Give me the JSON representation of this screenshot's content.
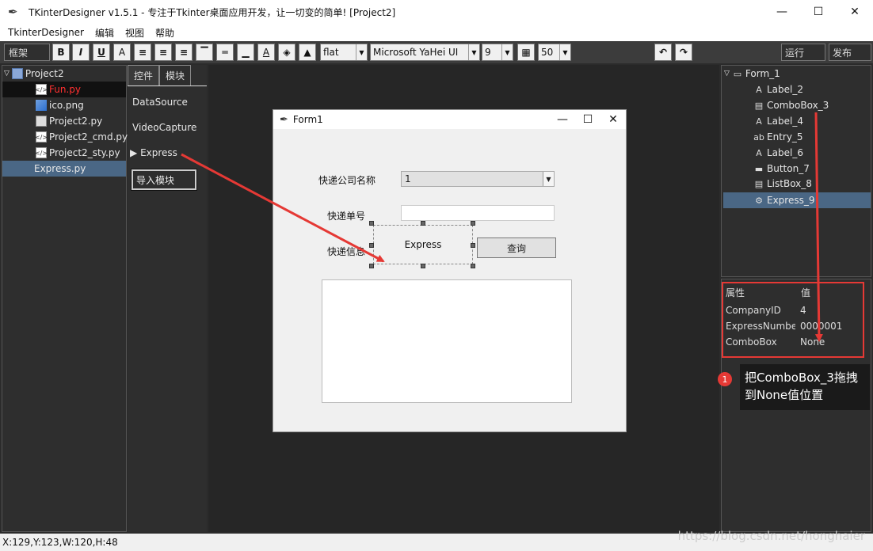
{
  "window": {
    "title": "TKinterDesigner v1.5.1 - 专注于Tkinter桌面应用开发，让一切变的简单!    [Project2]",
    "minimize": "—",
    "maximize": "☐",
    "close": "✕"
  },
  "menu": [
    "TkinterDesigner",
    "编辑",
    "视图",
    "帮助"
  ],
  "toolbar": {
    "frame_label": "框架",
    "bold": "B",
    "italic": "I",
    "underline": "U",
    "font_a": "A",
    "relief": "flat",
    "font_family": "Microsoft YaHei UI",
    "font_size": "9",
    "grid_size": "50",
    "run_label": "运行",
    "publish_label": "发布"
  },
  "project_tree": {
    "root": "Project2",
    "items": [
      "Fun.py",
      "ico.png",
      "Project2.py",
      "Project2_cmd.py",
      "Project2_sty.py",
      "Express.py"
    ]
  },
  "module_panel": {
    "tabs": [
      "控件",
      "模块"
    ],
    "items": [
      "DataSource",
      "VideoCapture",
      "Express"
    ],
    "import_button": "导入模块"
  },
  "form": {
    "title": "Form1",
    "label_company": "快递公司名称",
    "combo_value": "1",
    "label_number": "快递单号",
    "label_info": "快递信息",
    "express_widget": "Express",
    "query_button": "查询"
  },
  "object_tree": {
    "root": "Form_1",
    "items": [
      "Label_2",
      "ComboBox_3",
      "Label_4",
      "Entry_5",
      "Label_6",
      "Button_7",
      "ListBox_8",
      "Express_9"
    ],
    "selected": "Express_9"
  },
  "properties": {
    "header_name": "属性",
    "header_value": "值",
    "rows": [
      {
        "name": "CompanyID",
        "value": "4"
      },
      {
        "name": "ExpressNumbe",
        "value": "0000001"
      },
      {
        "name": "ComboBox",
        "value": "None"
      }
    ]
  },
  "annotation": {
    "badge": "1",
    "text": "把ComboBox_3拖拽到None值位置"
  },
  "status": "X:129,Y:123,W:120,H:48",
  "watermark": "https://blog.csdn.net/honghaier",
  "colors": {
    "highlight": "#e53935",
    "selection": "#4a6785",
    "error_file": "#ff3030"
  }
}
